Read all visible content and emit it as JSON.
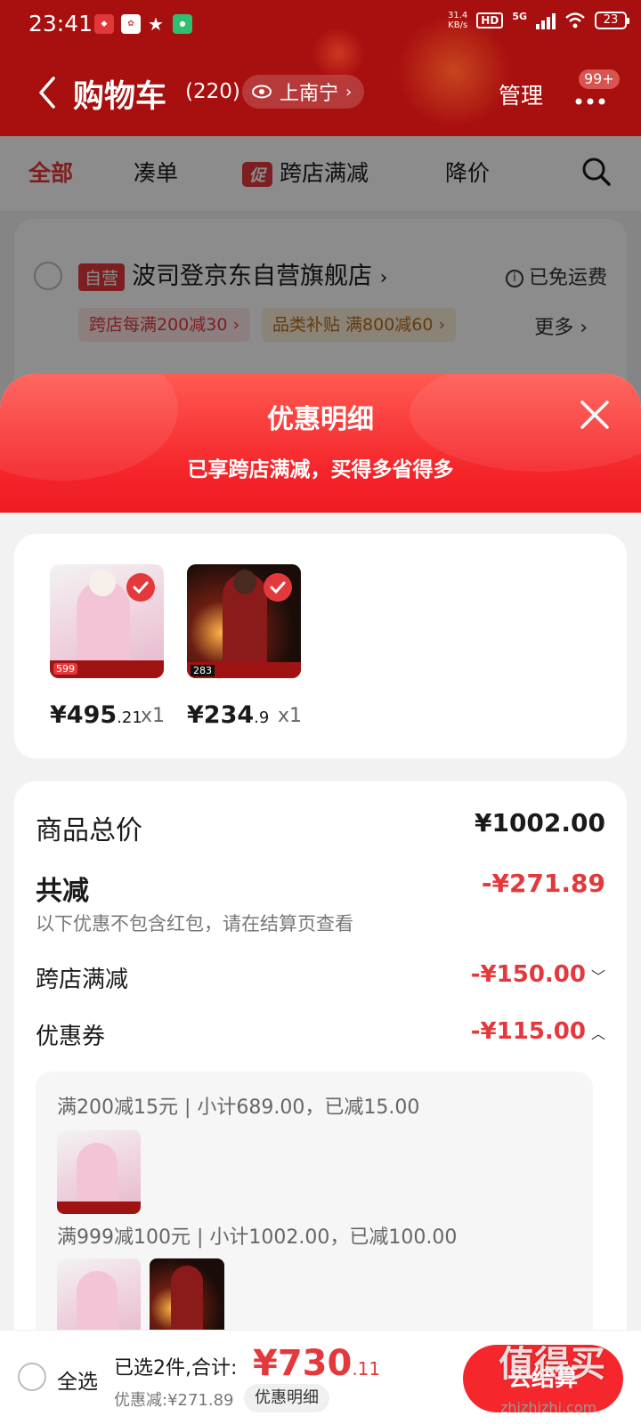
{
  "status_bar": {
    "time": "23:41",
    "net_speed_top": "31.4",
    "net_speed_unit": "KB/s",
    "hd": "HD",
    "cell": "5G",
    "battery": "23"
  },
  "header": {
    "title": "购物车",
    "count": "(220)",
    "location": "上南宁",
    "manage": "管理",
    "badge": "99+"
  },
  "tabs": [
    {
      "label": "全部"
    },
    {
      "label": "凑单"
    },
    {
      "label": "跨店满减",
      "tag": "促"
    },
    {
      "label": "降价"
    }
  ],
  "store": {
    "tag": "自营",
    "name": "波司登京东自营旗舰店",
    "shipping": "已免运费",
    "chip1": "跨店每满200减30",
    "chip2": "品类补贴  满800减60",
    "more": "更多"
  },
  "sheet": {
    "title": "优惠明细",
    "subtitle": "已享跨店满减，买得多省得多"
  },
  "products": [
    {
      "price_main": "¥495",
      "price_dec": ".21",
      "qty": "x1",
      "img_badge": "599"
    },
    {
      "price_main": "¥234",
      "price_dec": ".9",
      "qty": "x1",
      "img_badge": "283"
    }
  ],
  "summary": {
    "total_label": "商品总价",
    "total_value": "¥1002.00",
    "reduce_label": "共减",
    "reduce_value": "-¥271.89",
    "reduce_note": "以下优惠不包含红包，请在结算页查看",
    "cross_label": "跨店满减",
    "cross_value": "-¥150.00",
    "coupon_label": "优惠券",
    "coupon_value": "-¥115.00"
  },
  "coupons": {
    "line1": "满200减15元 | 小计689.00，已减15.00",
    "line2": "满999减100元 | 小计1002.00，已减100.00"
  },
  "bottom": {
    "select_all": "全选",
    "selected": "已选2件,合计:",
    "amount_main": "¥730",
    "amount_dec": ".11",
    "saved": "优惠减:¥271.89",
    "detail_btn": "优惠明细",
    "checkout": "去结算",
    "watermark": "值得买",
    "watermark_url": "zhizhizhi.com"
  },
  "colors": {
    "brand_red": "#e4393c",
    "header_dark_red": "#a80f0f"
  }
}
